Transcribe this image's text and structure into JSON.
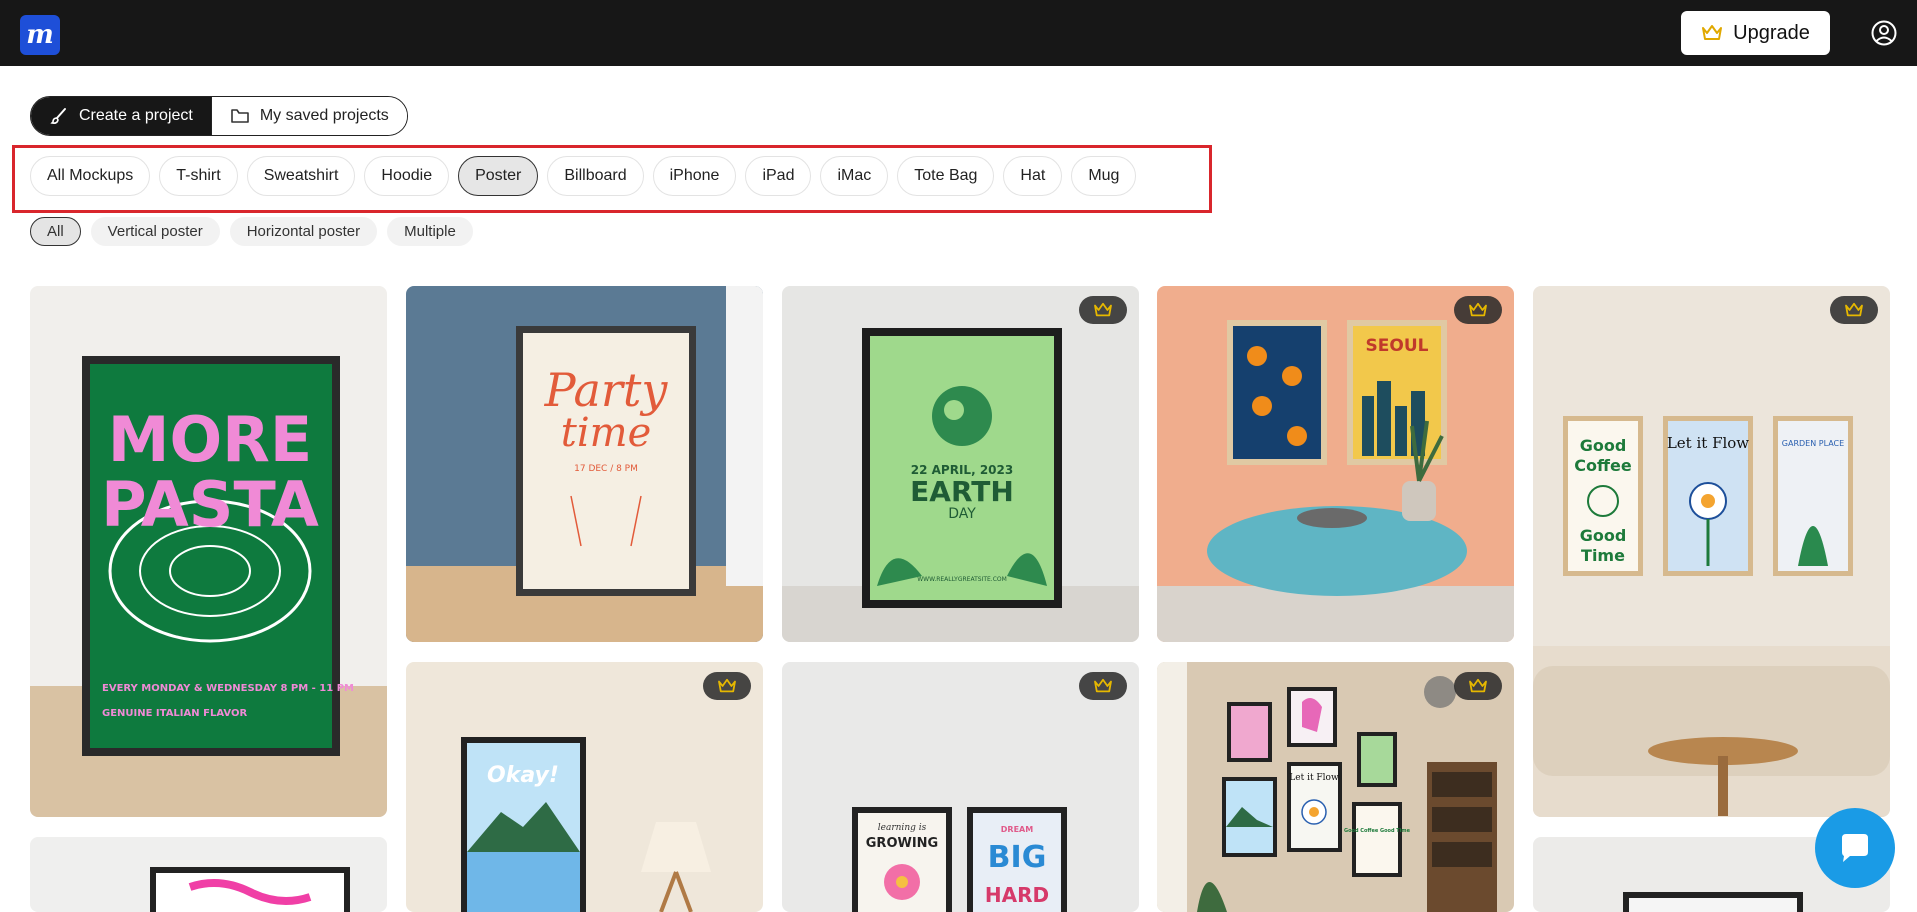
{
  "app": {
    "logo_letter": "m",
    "brand_color": "#1e4fd8"
  },
  "header": {
    "upgrade_label": "Upgrade",
    "icons": [
      "crown-icon",
      "user-circle-icon"
    ]
  },
  "project_toggle": {
    "create_label": "Create a project",
    "saved_label": "My saved projects"
  },
  "categories": [
    "All Mockups",
    "T-shirt",
    "Sweatshirt",
    "Hoodie",
    "Poster",
    "Billboard",
    "iPhone",
    "iPad",
    "iMac",
    "Tote Bag",
    "Hat",
    "Mug"
  ],
  "selected_category": "Poster",
  "subfilters": [
    "All",
    "Vertical poster",
    "Horizontal poster",
    "Multiple"
  ],
  "selected_subfilter": "All",
  "accent_highlight": "#d9262c",
  "posters": {
    "pasta": {
      "line1": "MORE",
      "line2": "PASTA",
      "left_note": "EVERY MONDAY & WEDNESDAY 8 PM - 11 PM",
      "right_note": "GENUINE ITALIAN FLAVOR"
    },
    "party": {
      "title1": "Party",
      "title2": "time",
      "date": "17 DEC / 8 PM"
    },
    "earth": {
      "date": "22 APRIL, 2023",
      "title": "EARTH",
      "subtitle": "DAY",
      "url": "WWW.REALLYGREATSITE.COM"
    },
    "seoul": {
      "title": "SEOUL"
    },
    "trio": {
      "left1": "Good",
      "left2": "Coffee",
      "left3": "Good",
      "left4": "Time",
      "middle": "Let it Flow",
      "right": "GARDEN PLACE"
    },
    "okay": {
      "title": "Okay!"
    },
    "growing": {
      "left1": "learning is",
      "left2": "GROWING",
      "right1": "DREAM",
      "right2": "BIG",
      "right3": "HARD"
    },
    "gallery": {
      "sign1": "Let it Flow",
      "sign2": "Good Coffee Good Time"
    }
  }
}
